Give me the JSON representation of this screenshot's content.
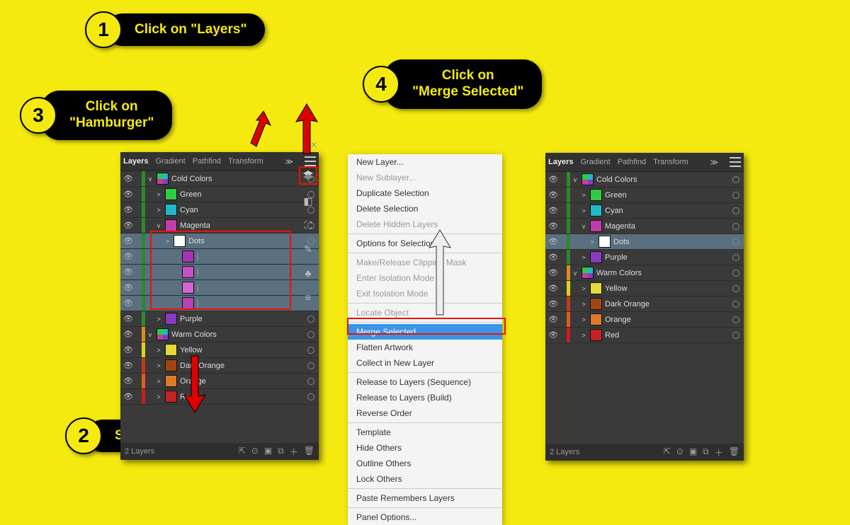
{
  "callouts": {
    "c1": {
      "num": "1",
      "text": "Click on \"Layers\""
    },
    "c2": {
      "num": "2",
      "text": "Select Sublayers"
    },
    "c3": {
      "num": "3",
      "text": "Click on\n\"Hamburger\""
    },
    "c4": {
      "num": "4",
      "text": "Click on\n\"Merge Selected\""
    }
  },
  "panel_tabs": [
    "Layers",
    "Gradient",
    "Pathfind",
    "Transform"
  ],
  "panel1_layers": [
    {
      "name": "Cold Colors",
      "color": "#2b8a2b",
      "depth": 0,
      "toggle": "v",
      "multi": true
    },
    {
      "name": "Green",
      "color": "#2b8a2b",
      "depth": 1,
      "toggle": ">",
      "sw": "#2ecc40"
    },
    {
      "name": "Cyan",
      "color": "#2b8a2b",
      "depth": 1,
      "toggle": ">",
      "sw": "#1fb9c9"
    },
    {
      "name": "Magenta",
      "color": "#2b8a2b",
      "depth": 1,
      "toggle": "v",
      "sw": "#c23da8"
    },
    {
      "name": "Dots",
      "color": "#2b8a2b",
      "depth": 2,
      "toggle": ">",
      "sw": "#ffffff",
      "sel": true
    },
    {
      "name": "<Ellip...",
      "color": "#2b8a2b",
      "depth": 3,
      "sw": "#a335b5",
      "sel": true
    },
    {
      "name": "<Ellip...",
      "color": "#2b8a2b",
      "depth": 3,
      "sw": "#c352c3",
      "sel": true
    },
    {
      "name": "<Ellip...",
      "color": "#2b8a2b",
      "depth": 3,
      "sw": "#d463d4",
      "sel": true
    },
    {
      "name": "<Ellip...",
      "color": "#2b8a2b",
      "depth": 3,
      "sw": "#b443b4",
      "sel": true
    },
    {
      "name": "Purple",
      "color": "#2b8a2b",
      "depth": 1,
      "toggle": ">",
      "sw": "#8a3abf"
    },
    {
      "name": "Warm Colors",
      "color": "#e08a1a",
      "depth": 0,
      "toggle": "v",
      "multi": true
    },
    {
      "name": "Yellow",
      "color": "#e0d21a",
      "depth": 1,
      "toggle": ">",
      "sw": "#e6d93a"
    },
    {
      "name": "Dark Orange",
      "color": "#c23a1a",
      "depth": 1,
      "toggle": ">",
      "sw": "#a34512"
    },
    {
      "name": "Orange",
      "color": "#e05a1a",
      "depth": 1,
      "toggle": ">",
      "sw": "#e07a2a"
    },
    {
      "name": "Red",
      "color": "#d11a1a",
      "depth": 1,
      "toggle": ">",
      "sw": "#c62222"
    }
  ],
  "panel2_layers": [
    {
      "name": "Cold Colors",
      "color": "#2b8a2b",
      "depth": 0,
      "toggle": "v",
      "multi": true
    },
    {
      "name": "Green",
      "color": "#2b8a2b",
      "depth": 1,
      "toggle": ">",
      "sw": "#2ecc40"
    },
    {
      "name": "Cyan",
      "color": "#2b8a2b",
      "depth": 1,
      "toggle": ">",
      "sw": "#1fb9c9"
    },
    {
      "name": "Magenta",
      "color": "#2b8a2b",
      "depth": 1,
      "toggle": "v",
      "sw": "#c23da8"
    },
    {
      "name": "Dots",
      "color": "#2b8a2b",
      "depth": 2,
      "toggle": ">",
      "sw": "#ffffff",
      "sel": true
    },
    {
      "name": "Purple",
      "color": "#2b8a2b",
      "depth": 1,
      "toggle": ">",
      "sw": "#8a3abf"
    },
    {
      "name": "Warm Colors",
      "color": "#e08a1a",
      "depth": 0,
      "toggle": "v",
      "multi": true
    },
    {
      "name": "Yellow",
      "color": "#e0d21a",
      "depth": 1,
      "toggle": ">",
      "sw": "#e6d93a"
    },
    {
      "name": "Dark Orange",
      "color": "#c23a1a",
      "depth": 1,
      "toggle": ">",
      "sw": "#a34512"
    },
    {
      "name": "Orange",
      "color": "#e05a1a",
      "depth": 1,
      "toggle": ">",
      "sw": "#e07a2a"
    },
    {
      "name": "Red",
      "color": "#d11a1a",
      "depth": 1,
      "toggle": ">",
      "sw": "#c62222"
    }
  ],
  "footer_text": "2 Layers",
  "menu_items": [
    {
      "label": "New Layer...",
      "dis": false
    },
    {
      "label": "New Sublayer...",
      "dis": true
    },
    {
      "label": "Duplicate Selection",
      "dis": false
    },
    {
      "label": "Delete Selection",
      "dis": false
    },
    {
      "label": "Delete Hidden Layers",
      "dis": true
    },
    {
      "sep": true
    },
    {
      "label": "Options for Selection...",
      "dis": false
    },
    {
      "sep": true
    },
    {
      "label": "Make/Release Clipping Mask",
      "dis": true
    },
    {
      "label": "Enter Isolation Mode",
      "dis": true
    },
    {
      "label": "Exit Isolation Mode",
      "dis": true
    },
    {
      "sep": true
    },
    {
      "label": "Locate Object",
      "dis": true
    },
    {
      "sep": true
    },
    {
      "label": "Merge Selected",
      "dis": false,
      "hl": true
    },
    {
      "label": "Flatten Artwork",
      "dis": false
    },
    {
      "label": "Collect in New Layer",
      "dis": false
    },
    {
      "sep": true
    },
    {
      "label": "Release to Layers (Sequence)",
      "dis": false
    },
    {
      "label": "Release to Layers (Build)",
      "dis": false
    },
    {
      "label": "Reverse Order",
      "dis": false
    },
    {
      "sep": true
    },
    {
      "label": "Template",
      "dis": false
    },
    {
      "label": "Hide Others",
      "dis": false
    },
    {
      "label": "Outline Others",
      "dis": false
    },
    {
      "label": "Lock Others",
      "dis": false
    },
    {
      "sep": true
    },
    {
      "label": "Paste Remembers Layers",
      "dis": false
    },
    {
      "sep": true
    },
    {
      "label": "Panel Options...",
      "dis": false
    }
  ]
}
